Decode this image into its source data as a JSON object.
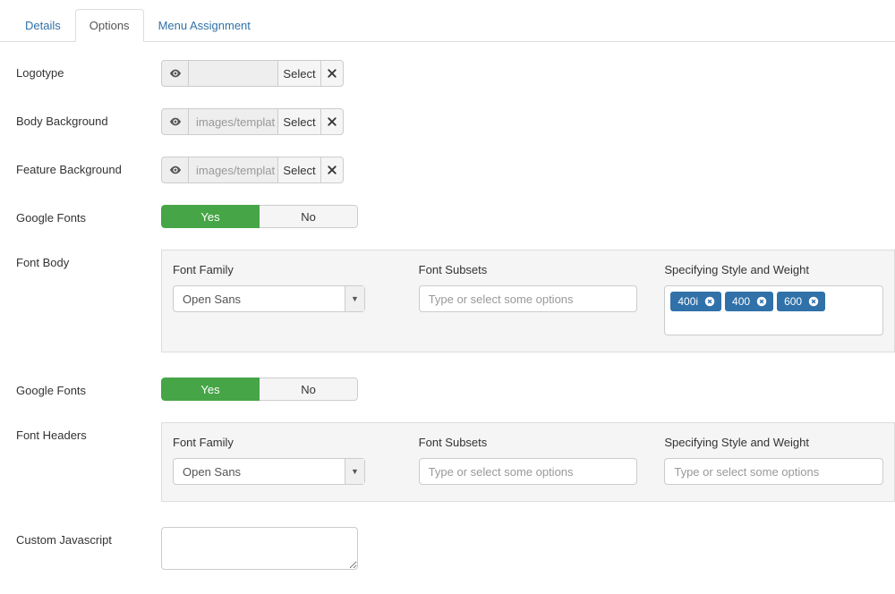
{
  "tabs": [
    {
      "label": "Details"
    },
    {
      "label": "Options"
    },
    {
      "label": "Menu Assignment"
    }
  ],
  "activeTab": 1,
  "fields": {
    "logotype": {
      "label": "Logotype",
      "value": "",
      "select": "Select"
    },
    "body_background": {
      "label": "Body Background",
      "value": "images/templat",
      "select": "Select"
    },
    "feature_background": {
      "label": "Feature Background",
      "value": "images/templat",
      "select": "Select"
    },
    "google_fonts_body": {
      "label": "Google Fonts",
      "yes": "Yes",
      "no": "No",
      "value": "Yes"
    },
    "google_fonts_headers": {
      "label": "Google Fonts",
      "yes": "Yes",
      "no": "No",
      "value": "Yes"
    },
    "font_body": {
      "label": "Font Body"
    },
    "font_headers": {
      "label": "Font Headers"
    },
    "custom_js": {
      "label": "Custom Javascript",
      "value": ""
    }
  },
  "panel_body": {
    "family_label": "Font Family",
    "family_value": "Open Sans",
    "subsets_label": "Font Subsets",
    "subsets_placeholder": "Type or select some options",
    "style_label": "Specifying Style and Weight",
    "tags": [
      "400i",
      "400",
      "600"
    ]
  },
  "panel_headers": {
    "family_label": "Font Family",
    "family_value": "Open Sans",
    "subsets_label": "Font Subsets",
    "subsets_placeholder": "Type or select some options",
    "style_label": "Specifying Style and Weight",
    "style_placeholder": "Type or select some options"
  }
}
